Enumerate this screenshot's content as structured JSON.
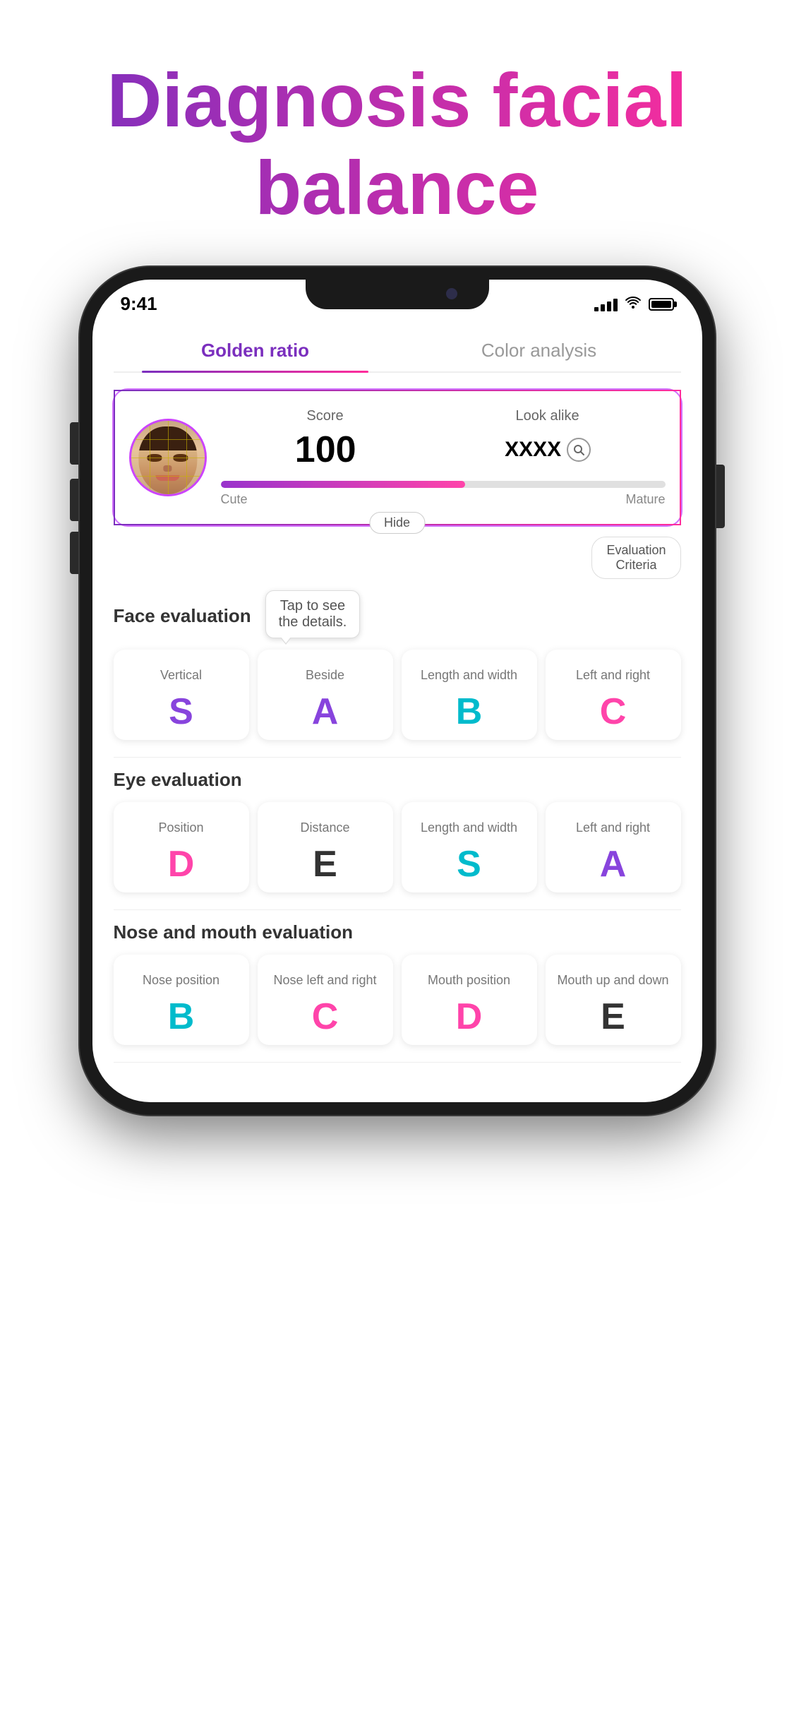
{
  "title": {
    "line1": "Diagnosis facial",
    "line2": "balance"
  },
  "status_bar": {
    "time": "9:41",
    "signal": "4 bars",
    "wifi": "on",
    "battery": "full"
  },
  "tabs": [
    {
      "id": "golden-ratio",
      "label": "Golden ratio",
      "active": true
    },
    {
      "id": "color-analysis",
      "label": "Color analysis",
      "active": false
    }
  ],
  "score_card": {
    "score_label": "Score",
    "look_alike_label": "Look alike",
    "score_value": "100",
    "look_alike_value": "XXXX",
    "hide_button": "Hide",
    "cute_label": "Cute",
    "mature_label": "Mature",
    "progress_percent": 55
  },
  "eval_criteria_btn": "Evaluation\nCriteria",
  "tooltip": "Tap to see\nthe details.",
  "face_evaluation": {
    "title": "Face evaluation",
    "cards": [
      {
        "label": "Vertical",
        "grade": "S",
        "color": "grade-purple"
      },
      {
        "label": "Beside",
        "grade": "A",
        "color": "grade-purple"
      },
      {
        "label": "Length and width",
        "grade": "B",
        "color": "grade-cyan"
      },
      {
        "label": "Left and right",
        "grade": "C",
        "color": "grade-pink"
      }
    ]
  },
  "eye_evaluation": {
    "title": "Eye evaluation",
    "cards": [
      {
        "label": "Position",
        "grade": "D",
        "color": "grade-pink"
      },
      {
        "label": "Distance",
        "grade": "E",
        "color": "grade-dark"
      },
      {
        "label": "Length and width",
        "grade": "S",
        "color": "grade-cyan"
      },
      {
        "label": "Left and right",
        "grade": "A",
        "color": "grade-purple"
      }
    ]
  },
  "nose_mouth_evaluation": {
    "title": "Nose and mouth evaluation",
    "cards": [
      {
        "label": "Nose position",
        "grade": "B",
        "color": "grade-cyan"
      },
      {
        "label": "Nose left and right",
        "grade": "C",
        "color": "grade-pink"
      },
      {
        "label": "Mouth position",
        "grade": "D",
        "color": "grade-pink"
      },
      {
        "label": "Mouth up and down",
        "grade": "E",
        "color": "grade-dark"
      }
    ]
  }
}
